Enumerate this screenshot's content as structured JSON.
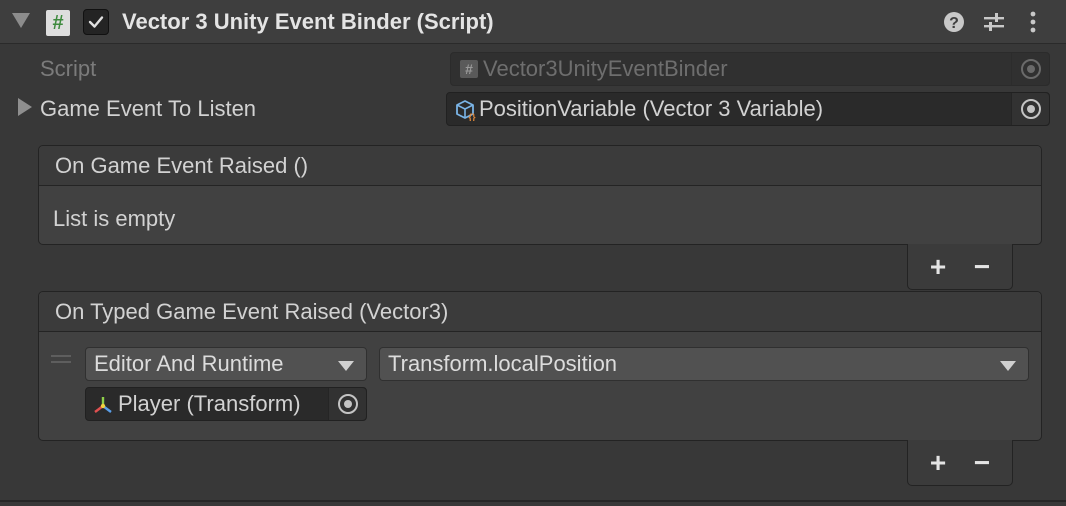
{
  "component": {
    "title": "Vector 3 Unity Event Binder (Script)",
    "enabled": true,
    "header_icons": [
      "help-icon",
      "presets-icon",
      "more-options-icon"
    ]
  },
  "fields": {
    "script": {
      "label": "Script",
      "value": "Vector3UnityEventBinder"
    },
    "game_event": {
      "label": "Game Event To Listen",
      "value": "PositionVariable (Vector 3 Variable)"
    }
  },
  "events": [
    {
      "title": "On Game Event Raised ()",
      "empty_text": "List is empty"
    },
    {
      "title": "On Typed Game Event Raised (Vector3)",
      "listener": {
        "mode": "Editor And Runtime",
        "function": "Transform.localPosition",
        "target": "Player (Transform)"
      }
    }
  ],
  "buttons": {
    "add": "+",
    "remove": "−"
  },
  "colors": {
    "accent_green": "#3e8a3e",
    "panel_bg": "#383838"
  }
}
